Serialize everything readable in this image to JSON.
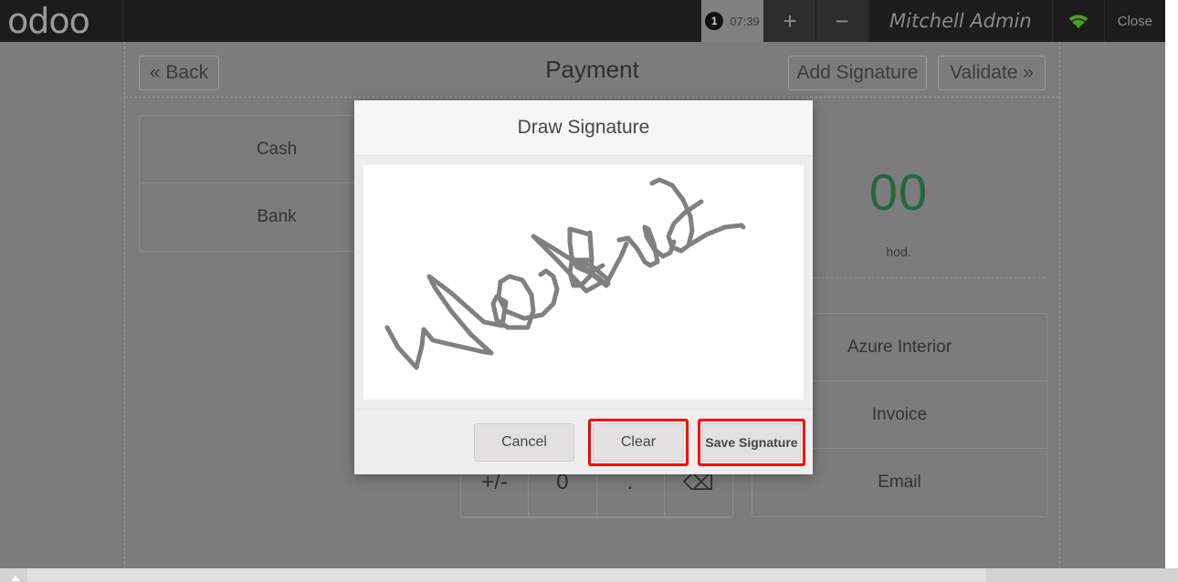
{
  "header": {
    "logo_text": "odoo",
    "order_tab": {
      "badge": "1",
      "time": "07:39"
    },
    "add_order_label": "+",
    "remove_order_label": "−",
    "user_name": "Mitchell Admin",
    "wifi_icon": "wifi-icon",
    "wifi_color": "#4a9e22",
    "close_label": "Close"
  },
  "payment_screen": {
    "back_label": "« Back",
    "title": "Payment",
    "add_signature_label": "Add Signature",
    "validate_label": "Validate »",
    "payment_methods": [
      {
        "label": "Cash"
      },
      {
        "label": "Bank"
      }
    ],
    "amount": "00",
    "amount_color": "#26663f",
    "amount_note": "hod.",
    "numpad_keys": [
      "+/-",
      "0",
      ".",
      "⌫"
    ],
    "backspace_icon": "backspace-icon",
    "summary_rows": [
      {
        "label": "Azure Interior"
      },
      {
        "label": "Invoice"
      },
      {
        "label": "Email"
      }
    ]
  },
  "modal": {
    "title": "Draw Signature",
    "signature_alt": "drawn-signature",
    "signature_stroke_color": "#808080",
    "buttons": [
      {
        "label": "Cancel",
        "highlighted": false
      },
      {
        "label": "Clear",
        "highlighted": true
      },
      {
        "label": "Save Signature",
        "highlighted": true
      }
    ],
    "highlight_color": "#fe0000"
  }
}
